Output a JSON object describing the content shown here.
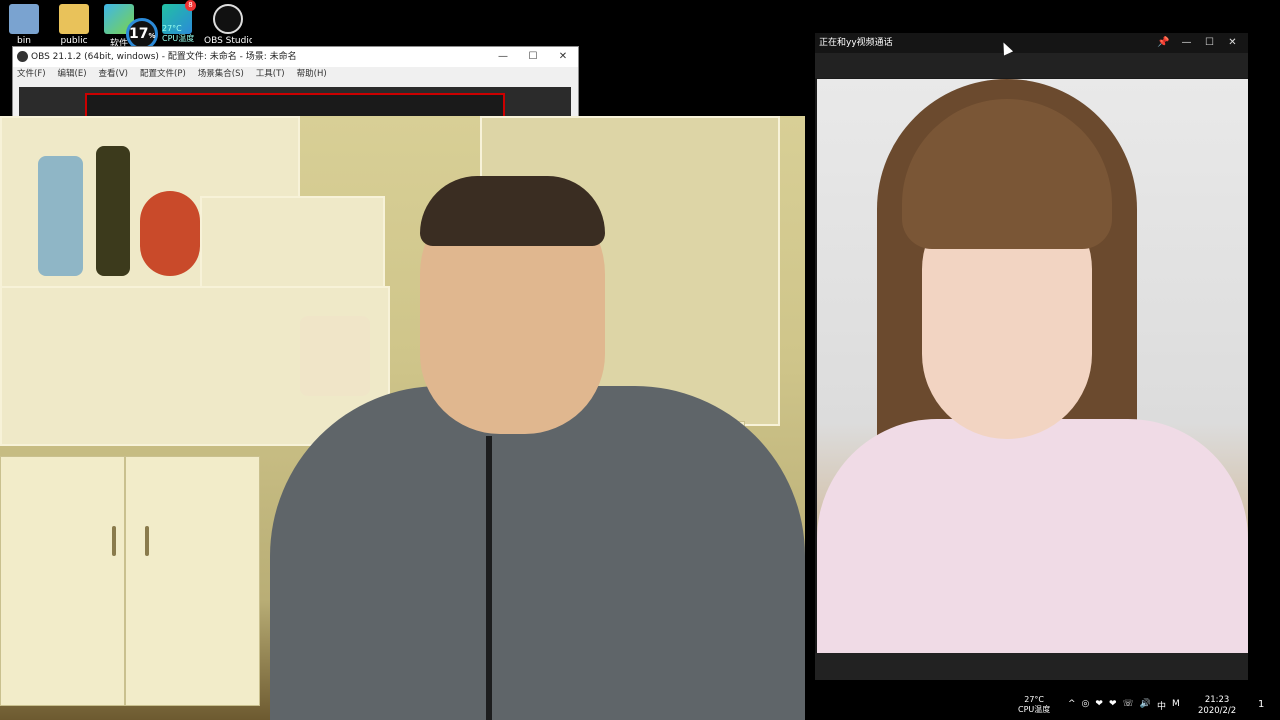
{
  "desktop": {
    "icons": [
      {
        "label": "bin",
        "icon": "recycle-bin-icon"
      },
      {
        "label": "public",
        "icon": "folder-icon"
      },
      {
        "label": "软件",
        "icon": "app-icon"
      },
      {
        "label": "",
        "icon": "monitor-widget-icon"
      },
      {
        "label": "OBS Studio",
        "icon": "obs-studio-icon"
      }
    ],
    "cpu_widget": {
      "percent": "17",
      "percent_unit": "%",
      "temp": "27°C",
      "label": "CPU温度"
    }
  },
  "obs_window": {
    "title": "OBS 21.1.2 (64bit, windows) - 配置文件: 未命名 - 场景: 未命名",
    "menu": [
      "文件(F)",
      "编辑(E)",
      "查看(V)",
      "配置文件(P)",
      "场景集合(S)",
      "工具(T)",
      "帮助(H)"
    ],
    "controls": {
      "minimize": "—",
      "maximize": "☐",
      "close": "✕"
    }
  },
  "call_window": {
    "title": "正在和yy视频通话",
    "controls": {
      "pin": "📌",
      "minimize": "—",
      "maximize": "☐",
      "close": "✕"
    }
  },
  "taskbar": {
    "cpu_temp": "27°C",
    "cpu_label": "CPU温度",
    "tray_icons": [
      "^",
      "◎",
      "❤",
      "❤",
      "☏",
      "🔊",
      "中",
      "M"
    ],
    "time": "21:23",
    "date": "2020/2/2",
    "notification_count": "1"
  },
  "colors": {
    "accent_blue": "#2b8ad8",
    "recording_border": "#cc0000",
    "desktop_bg": "#000000"
  }
}
